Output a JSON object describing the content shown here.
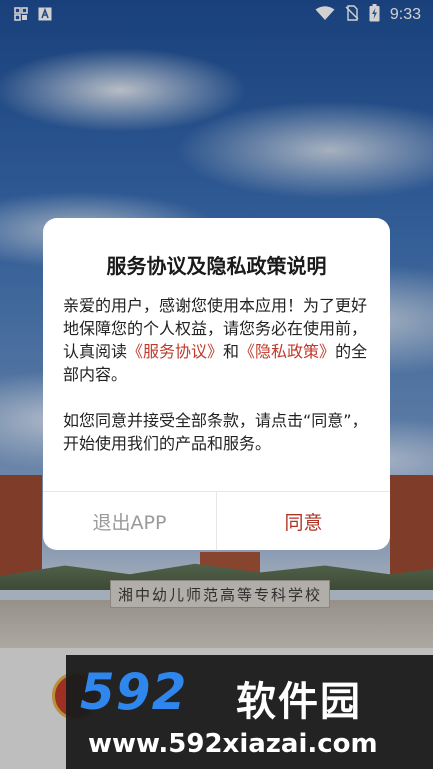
{
  "status_bar": {
    "time": "9:33",
    "icons": [
      "grid-icon",
      "app-a-icon",
      "wifi-icon",
      "no-sim-icon",
      "battery-charging-icon"
    ]
  },
  "background": {
    "campus_sign": "湘中幼儿师范高等专科学校"
  },
  "dialog": {
    "title": "服务协议及隐私政策说明",
    "para1_part1": "亲爱的用户，感谢您使用本应用！为了更好地保障您的个人权益，请您务必在使用前，认真阅读",
    "link_service": "《服务协议》",
    "para1_and": "和",
    "link_privacy": "《隐私政策》",
    "para1_part2": "的全部内容。",
    "para2": "如您同意并接受全部条款，请点击“同意”，开始使用我们的产品和服务。",
    "exit_label": "退出APP",
    "agree_label": "同意"
  },
  "watermark": {
    "number": "592",
    "brand": "软件园",
    "url": "www.592xiazai.com"
  },
  "colors": {
    "link": "#c0392b",
    "agree": "#b03426",
    "exit": "#9a9a9a",
    "watermark_blue": "#2f86ec"
  }
}
